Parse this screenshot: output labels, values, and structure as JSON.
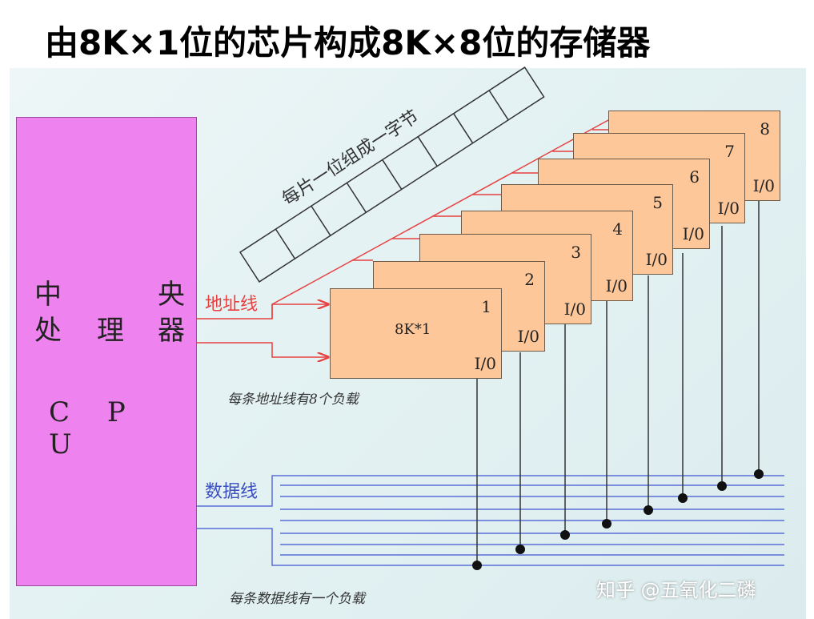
{
  "title": "由8K×1位的芯片构成8K×8位的存储器",
  "cpu": {
    "chars": [
      "中",
      "央",
      "处",
      "理",
      "器"
    ],
    "abbr": "C P U"
  },
  "chips": [
    {
      "number": "1",
      "io": "I/0",
      "label": "8K*1"
    },
    {
      "number": "2",
      "io": "I/0"
    },
    {
      "number": "3",
      "io": "I/0"
    },
    {
      "number": "4",
      "io": "I/0"
    },
    {
      "number": "5",
      "io": "I/0"
    },
    {
      "number": "6",
      "io": "I/0"
    },
    {
      "number": "7",
      "io": "I/0"
    },
    {
      "number": "8",
      "io": "I/0"
    }
  ],
  "labels": {
    "address_line": "地址线",
    "data_line": "数据线",
    "byte_note": "每片一位组成一字节",
    "address_load_note": "每条地址线有8个负载",
    "data_load_note": "每条数据线有一个负载"
  },
  "colors": {
    "cpu": "#ee82ee",
    "chip": "#fdc79a",
    "address_line": "#e84040",
    "data_line": "#5a6fd8"
  },
  "watermark": "知乎 @五氧化二磷"
}
